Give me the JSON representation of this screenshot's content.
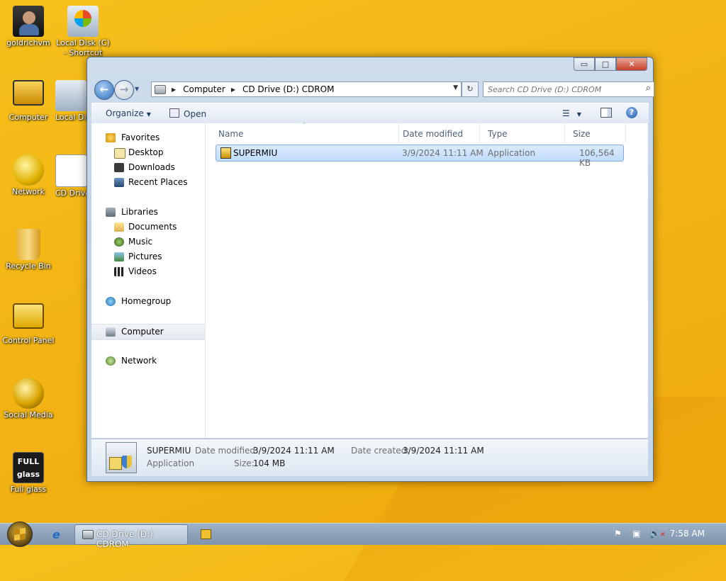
{
  "desktop": {
    "icons": [
      {
        "label": "goldrichvm",
        "icon": "user-folder-icon"
      },
      {
        "label": "Local Disk (C) - Shortcut",
        "icon": "drive-shortcut-icon"
      },
      {
        "label": "Computer",
        "icon": "computer-icon"
      },
      {
        "label": "Local Disk - Shortcut",
        "icon": "drive-shortcut-icon"
      },
      {
        "label": "Network",
        "icon": "network-icon"
      },
      {
        "label": "CD Drive - Shortcut",
        "icon": "cd-shortcut-icon"
      },
      {
        "label": "Recycle Bin",
        "icon": "recycle-bin-icon"
      },
      {
        "label": "Control Panel",
        "icon": "control-panel-icon"
      },
      {
        "label": "Social Media",
        "icon": "globe-icon"
      },
      {
        "label": "Full glass",
        "icon": "full-glass-icon"
      }
    ],
    "fullglass_badge": "FULL glass"
  },
  "window": {
    "controls": {
      "minimize": "▭",
      "maximize": "□",
      "close": "✕"
    },
    "address": {
      "crumbs": [
        "Computer",
        "CD Drive (D:) CDROM"
      ]
    },
    "search": {
      "placeholder": "Search CD Drive (D:) CDROM"
    },
    "toolbar": {
      "organize": "Organize",
      "open": "Open"
    },
    "nav": {
      "favorites": "Favorites",
      "desktop": "Desktop",
      "downloads": "Downloads",
      "recent": "Recent Places",
      "libraries": "Libraries",
      "documents": "Documents",
      "music": "Music",
      "pictures": "Pictures",
      "videos": "Videos",
      "homegroup": "Homegroup",
      "computer": "Computer",
      "network": "Network"
    },
    "columns": {
      "name": "Name",
      "date": "Date modified",
      "type": "Type",
      "size": "Size"
    },
    "files": [
      {
        "name": "SUPERMIU",
        "date": "3/9/2024 11:11 AM",
        "type": "Application",
        "size": "106,564 KB"
      }
    ],
    "details": {
      "name": "SUPERMIU",
      "type": "Application",
      "date_modified_label": "Date modified:",
      "date_modified": "3/9/2024 11:11 AM",
      "date_created_label": "Date created:",
      "date_created": "3/9/2024 11:11 AM",
      "size_label": "Size:",
      "size": "104 MB"
    }
  },
  "taskbar": {
    "active_window": "CD Drive (D:) CDROM",
    "clock": "7:58 AM"
  },
  "colors": {
    "selection": "#c1dcfb",
    "wallpaper": "#f2b415",
    "taskbar": "#8aa0b8"
  }
}
